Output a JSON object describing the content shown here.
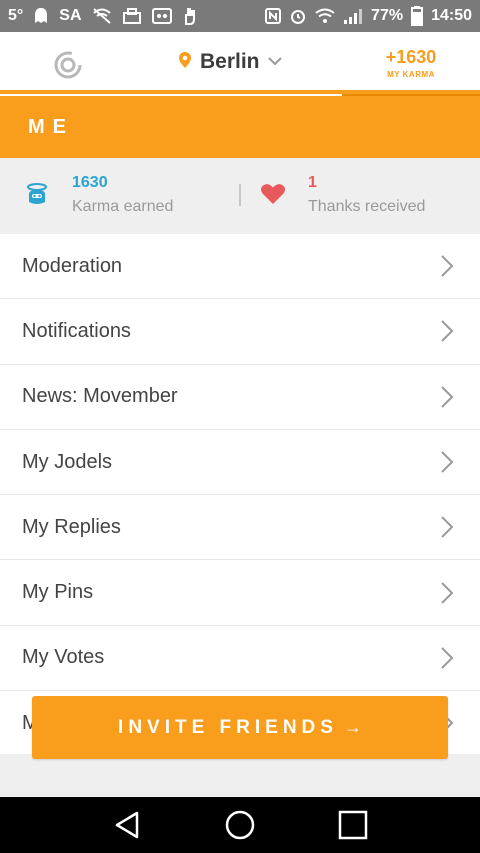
{
  "status_bar": {
    "temperature": "5°",
    "carrier": "SA",
    "battery": "77%",
    "time": "14:50"
  },
  "app_bar": {
    "location": "Berlin",
    "karma_value": "+1630",
    "karma_label": "MY KARMA"
  },
  "section": {
    "title": "ME"
  },
  "stats": {
    "karma": {
      "value": "1630",
      "label": "Karma earned"
    },
    "thanks": {
      "value": "1",
      "label": "Thanks received"
    }
  },
  "menu": {
    "items": [
      {
        "label": "Moderation"
      },
      {
        "label": "Notifications"
      },
      {
        "label": "News: Movember"
      },
      {
        "label": "My Jodels"
      },
      {
        "label": "My Replies"
      },
      {
        "label": "My Pins"
      },
      {
        "label": "My Votes"
      },
      {
        "label": "M"
      }
    ]
  },
  "invite": {
    "label": "INVITE FRIENDS",
    "arrow": "→"
  },
  "colors": {
    "accent": "#f99d1c",
    "karma_blue": "#2aa4d0",
    "heart_red": "#e85a5a"
  }
}
